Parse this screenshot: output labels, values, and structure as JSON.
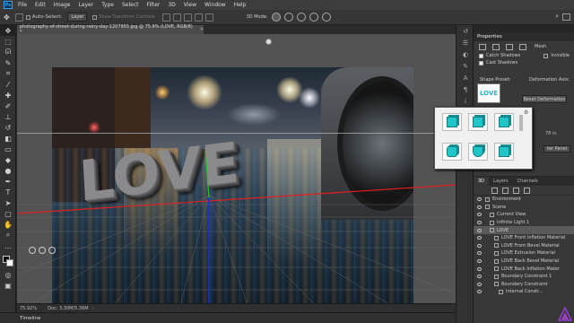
{
  "menu": {
    "logo": "Ps",
    "items": [
      "File",
      "Edit",
      "Image",
      "Layer",
      "Type",
      "Select",
      "Filter",
      "3D",
      "View",
      "Window",
      "Help"
    ]
  },
  "options": {
    "auto_select_label": "Auto-Select:",
    "auto_select_value": "Layer",
    "transform_label": "Show Transform Controls",
    "mode_label": "3D Mode:"
  },
  "document": {
    "tab_title": "photography-of-street-during-rainy-day-1207955.jpg @ 75.9% (LOVE, RGB/8) *",
    "close": "×",
    "love_text": "LOVE"
  },
  "status": {
    "zoom": "75.92%",
    "doc": "Doc: 3.30M/5.36M",
    "arrow": "›"
  },
  "timeline": {
    "label": "Timeline"
  },
  "properties": {
    "title": "Properties",
    "mesh_label": "Mesh",
    "catch_shadows": "Catch Shadows",
    "invisible": "Invisible",
    "cast_shadows": "Cast Shadows",
    "shape_preset": "Shape Preset:",
    "deformation_axis": "Deformation Axis:",
    "preset_thumb_text": "LOVE",
    "reset_deformation": "Reset Deformation",
    "right_val1": "",
    "right_val2": "78 in",
    "center_panel": "ter Panel"
  },
  "layers": {
    "tabs": [
      "3D",
      "Layers",
      "Channels"
    ],
    "rows": [
      {
        "label": "Environment",
        "indent": 0,
        "selected": false
      },
      {
        "label": "Scene",
        "indent": 0,
        "selected": false
      },
      {
        "label": "Current View",
        "indent": 1,
        "selected": false
      },
      {
        "label": "Infinite Light 1",
        "indent": 1,
        "selected": false
      },
      {
        "label": "LOVE",
        "indent": 1,
        "selected": true
      },
      {
        "label": "LOVE Front Inflation Material",
        "indent": 2,
        "selected": false
      },
      {
        "label": "LOVE Front Bevel Material",
        "indent": 2,
        "selected": false
      },
      {
        "label": "LOVE Extrusion Material",
        "indent": 2,
        "selected": false
      },
      {
        "label": "LOVE Back Bevel Material",
        "indent": 2,
        "selected": false
      },
      {
        "label": "LOVE Back Inflation Mater",
        "indent": 2,
        "selected": false
      },
      {
        "label": "Boundary Constraint 1",
        "indent": 2,
        "selected": false
      },
      {
        "label": "Boundary Constraint",
        "indent": 2,
        "selected": false
      },
      {
        "label": "Internal Constr...",
        "indent": 3,
        "selected": false
      }
    ]
  },
  "colors": {
    "accent_cyan": "#1fc5c9",
    "axis_red": "#e02020",
    "axis_blue": "#2030e0",
    "axis_green": "#30c030"
  }
}
